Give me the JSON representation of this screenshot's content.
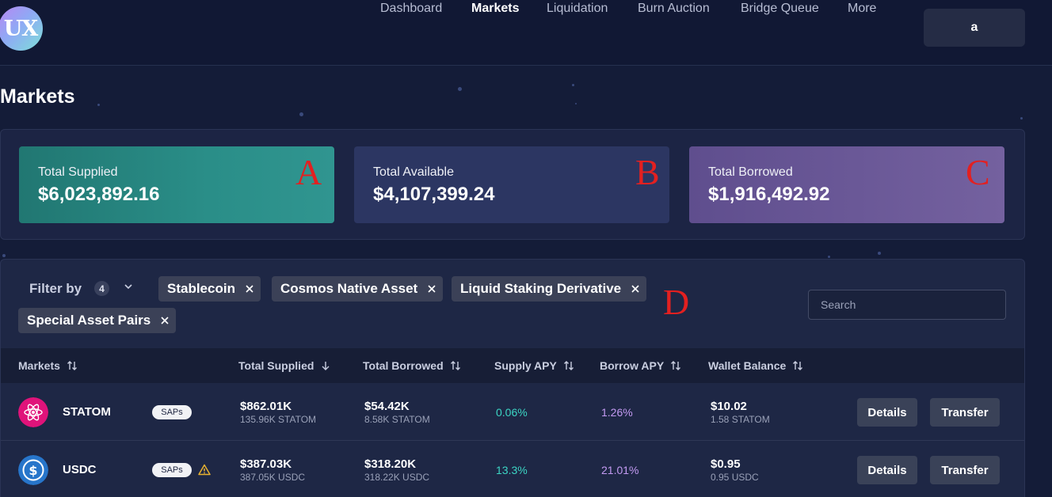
{
  "header": {
    "logo_text": "UX",
    "nav": [
      "Dashboard",
      "Markets",
      "Liquidation",
      "Burn Auction",
      "Bridge Queue",
      "More"
    ],
    "active_nav": "Markets",
    "account_label": "a"
  },
  "page_title": "Markets",
  "stats": {
    "total_supplied": {
      "label": "Total Supplied",
      "value": "$6,023,892.16",
      "marker": "A"
    },
    "total_available": {
      "label": "Total Available",
      "value": "$4,107,399.24",
      "marker": "B"
    },
    "total_borrowed": {
      "label": "Total Borrowed",
      "value": "$1,916,492.92",
      "marker": "C"
    }
  },
  "filters": {
    "label": "Filter by",
    "count": "4",
    "chips": [
      "Stablecoin",
      "Cosmos Native Asset",
      "Liquid Staking Derivative",
      "Special Asset Pairs"
    ],
    "marker": "D",
    "search_placeholder": "Search"
  },
  "table": {
    "columns": [
      "Markets",
      "Total Supplied",
      "Total Borrowed",
      "Supply APY",
      "Borrow APY",
      "Wallet Balance"
    ],
    "sorted_column": "Total Supplied",
    "sort_direction": "descending",
    "rows": [
      {
        "name": "STATOM",
        "tag": "SAPs",
        "warning": false,
        "icon": "cosmos-atom-icon",
        "icon_color": "#e0137a",
        "total_supplied": "$862.01K",
        "total_supplied_sub": "135.96K STATOM",
        "total_borrowed": "$54.42K",
        "total_borrowed_sub": "8.58K STATOM",
        "supply_apy": "0.06%",
        "borrow_apy": "1.26%",
        "wallet_balance": "$10.02",
        "wallet_balance_sub": "1.58 STATOM",
        "details_label": "Details",
        "transfer_label": "Transfer"
      },
      {
        "name": "USDC",
        "tag": "SAPs",
        "warning": true,
        "icon": "usdc-dollar-icon",
        "icon_color": "#2775ca",
        "total_supplied": "$387.03K",
        "total_supplied_sub": "387.05K USDC",
        "total_borrowed": "$318.20K",
        "total_borrowed_sub": "318.22K USDC",
        "supply_apy": "13.3%",
        "borrow_apy": "21.01%",
        "wallet_balance": "$0.95",
        "wallet_balance_sub": "0.95 USDC",
        "details_label": "Details",
        "transfer_label": "Transfer"
      }
    ]
  },
  "colors": {
    "background": "#141c38",
    "supply_apy": "#3cd6c4",
    "borrow_apy": "#c39af2",
    "marker_red": "#e32020"
  }
}
